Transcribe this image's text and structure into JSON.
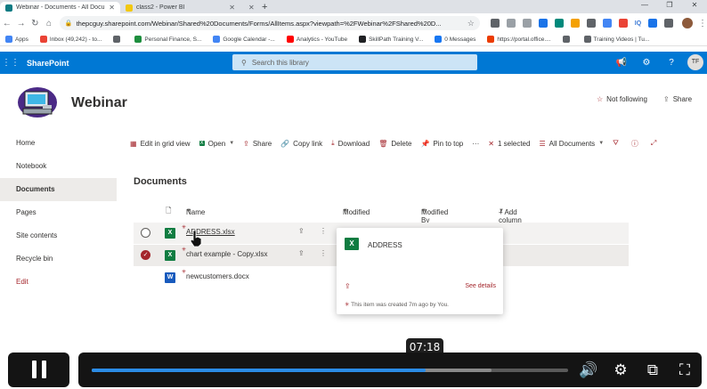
{
  "browser": {
    "tabs": [
      {
        "title": "Webinar - Documents - All Docu",
        "active": true,
        "color": "#0f7b83"
      },
      {
        "title": "class2 - Power BI",
        "active": false,
        "color": "#f2c811"
      },
      {
        "title": "",
        "active": false,
        "color": ""
      }
    ],
    "url": "thepcguy.sharepoint.com/Webinar/Shared%20Documents/Forms/AllItems.aspx?viewpath=%2FWebinar%2FShared%20D...",
    "bookmarks": [
      {
        "label": "Apps",
        "color": "#4285f4"
      },
      {
        "label": "Inbox (49,242) - to...",
        "color": "#ea4335"
      },
      {
        "label": "",
        "color": "#5f6368"
      },
      {
        "label": "Personal Finance, S...",
        "color": "#1e8e3e"
      },
      {
        "label": "Google Calendar -...",
        "color": "#4285f4"
      },
      {
        "label": "Analytics - YouTube",
        "color": "#ff0000"
      },
      {
        "label": "SkillPath Training V...",
        "color": "#202124"
      },
      {
        "label": "0 Messages",
        "color": "#1877f2"
      },
      {
        "label": "https://portal.office....",
        "color": "#eb3c00"
      },
      {
        "label": "",
        "color": "#5f6368"
      },
      {
        "label": "Training Videos | Tu...",
        "color": "#5f6368"
      }
    ],
    "ext_badge": "IQ"
  },
  "suite": {
    "brand": "SharePoint",
    "search_placeholder": "Search this library",
    "user_initials": "TF"
  },
  "site": {
    "title": "Webinar",
    "follow_label": "Not following",
    "share_label": "Share"
  },
  "nav": {
    "items": [
      "Home",
      "Notebook",
      "Documents",
      "Pages",
      "Site contents",
      "Recycle bin",
      "Edit"
    ],
    "active": "Documents"
  },
  "commands": {
    "edit_grid": "Edit in grid view",
    "open": "Open",
    "share": "Share",
    "copy_link": "Copy link",
    "download": "Download",
    "delete": "Delete",
    "pin": "Pin to top",
    "more": "···",
    "selected": "1 selected",
    "view": "All Documents"
  },
  "library": {
    "title": "Documents",
    "columns": {
      "name": "Name",
      "modified": "Modified",
      "modified_by": "Modified By",
      "add": "+ Add column"
    },
    "files": [
      {
        "name": "ADDRESS.xlsx",
        "type": "xlsx",
        "selected": false
      },
      {
        "name": "chart example - Copy.xlsx",
        "type": "xlsx",
        "selected": true
      },
      {
        "name": "newcustomers.docx",
        "type": "docx",
        "selected": false
      }
    ]
  },
  "hovercard": {
    "title": "ADDRESS",
    "see_details": "See details",
    "footer": "This item was created 7m ago by You."
  },
  "video": {
    "time": "07:18",
    "played_fraction": 0.7,
    "buffered_fraction": 0.84
  },
  "colors": {
    "suite_blue": "#0078d4",
    "accent_red": "#a4262c",
    "excel_green": "#107c41",
    "word_blue": "#185abd"
  }
}
